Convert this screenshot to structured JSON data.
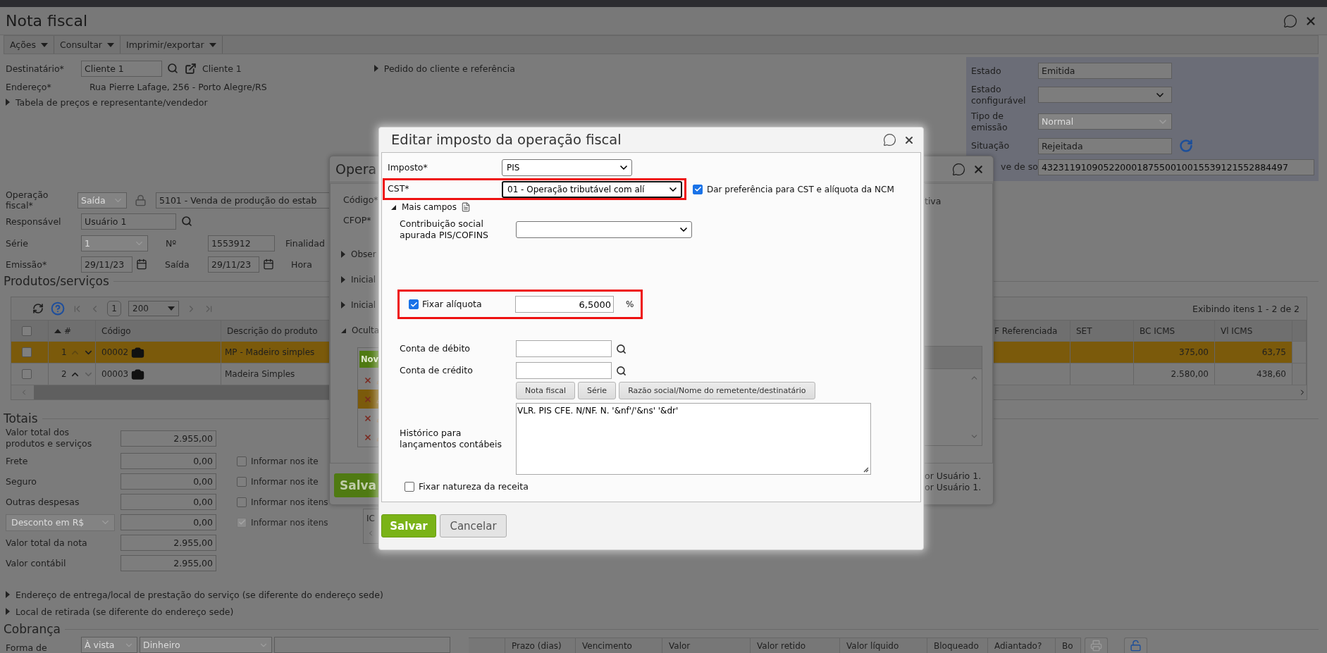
{
  "window": {
    "title": "Nota fiscal"
  },
  "menu": [
    {
      "label": "Ações"
    },
    {
      "label": "Consultar"
    },
    {
      "label": "Imprimir/exportar"
    }
  ],
  "header": {
    "recipient": {
      "label": "Destinatário*",
      "value": "Cliente 1",
      "link": "Cliente 1"
    },
    "address": {
      "label": "Endereço*",
      "value": "Rua Pierre Lafage, 256 - Porto Alegre/RS"
    },
    "price_section": {
      "label": "Tabela de preços e representante/vendedor",
      "expanded": false
    },
    "order_section": {
      "label": "Pedido do cliente e referência",
      "expanded": false
    }
  },
  "status_panel": [
    {
      "kind": "text",
      "label": "Estado",
      "value": "Emitida",
      "disabled": true,
      "refresh": false
    },
    {
      "kind": "select",
      "label": "Estado configurável",
      "disabled": false,
      "refresh": false
    },
    {
      "kind": "select",
      "label": "Tipo de emissão",
      "value": "Normal",
      "disabled": true,
      "refresh": false
    },
    {
      "kind": "text",
      "label": "Situação",
      "value": "Rejeitada",
      "disabled": true,
      "refresh": true
    },
    {
      "kind": "text",
      "label": "ve de so",
      "value": "43231191090522000187550010015539121552884497",
      "disabled": false,
      "refresh": false
    }
  ],
  "operation": {
    "label": "Operação fiscal*",
    "direction": "Saída",
    "cfop": "5101 - Venda de produção do estab"
  },
  "responsible": {
    "label": "Responsável",
    "value": "Usuário 1"
  },
  "series": {
    "label": "Série",
    "value": "1",
    "number_label": "Nº",
    "number": "1553912",
    "purpose_label": "Finalidad"
  },
  "dates": {
    "issue_label": "Emissão*",
    "issue": "29/11/23",
    "exit_label": "Saída",
    "exit": "29/11/23",
    "time_label": "Hora"
  },
  "products": {
    "title": "Produtos/serviços",
    "page": "1",
    "page_size": "200",
    "summary": "Exibindo itens 1 - 2 de 2",
    "header_checked": false,
    "columns": [
      {
        "label": "#",
        "sorted": true
      },
      {
        "label": "Código",
        "sorted": false
      },
      {
        "label": "Descrição do produto",
        "sorted": false
      },
      {
        "label": "F Referenciada",
        "sorted": false
      },
      {
        "label": "SET",
        "sorted": false
      },
      {
        "label": "BC ICMS",
        "sorted": false
      },
      {
        "label": "Vl ICMS",
        "sorted": false
      }
    ],
    "rows": [
      {
        "number": "1",
        "code": "00002",
        "description": "MP - Madeiro simples",
        "bc_icms": "375,00",
        "vl_icms": "63,75",
        "selected": true,
        "checked": false,
        "can_move_up": false,
        "can_move_down": true
      },
      {
        "number": "2",
        "code": "00003",
        "description": "Madeira Simples",
        "bc_icms": "2.580,00",
        "vl_icms": "438,60",
        "selected": false,
        "checked": false,
        "can_move_up": true,
        "can_move_down": false
      }
    ]
  },
  "totals": {
    "title": "Totais",
    "rows": [
      {
        "kind": "input",
        "label": "Valor total dos produtos e serviços",
        "value": "2.955,00"
      },
      {
        "kind": "input",
        "label": "Frete",
        "value": "0,00",
        "inform": {
          "label": "Informar nos ite",
          "checked": false,
          "disabled": false
        }
      },
      {
        "kind": "input",
        "label": "Seguro",
        "value": "0,00",
        "inform": {
          "label": "Informar nos ite",
          "checked": false,
          "disabled": false
        }
      },
      {
        "kind": "input",
        "label": "Outras despesas",
        "value": "0,00",
        "inform": {
          "label": "Informar nos itens",
          "checked": false,
          "disabled": false
        }
      },
      {
        "kind": "select",
        "label": "Desconto em R$",
        "value": "0,00",
        "inform": {
          "label": "Informar nos itens",
          "checked": true,
          "disabled": true
        }
      },
      {
        "kind": "input",
        "label": "Valor total da nota",
        "value": "2.955,00"
      },
      {
        "kind": "input",
        "label": "Valor contábil",
        "value": "2.955,00"
      }
    ]
  },
  "sections": [
    {
      "label": "Endereço de entrega/local de prestação do serviço (se diferente do endereço sede)",
      "expanded": false
    },
    {
      "label": "Local de retirada (se diferente do endereço sede)",
      "expanded": false
    }
  ],
  "billing": {
    "title": "Cobrança",
    "form_label": "Forma de",
    "term": "À vista",
    "method": "Dinheiro",
    "columns": [
      {
        "label": "Prazo (dias)"
      },
      {
        "label": "Vencimento"
      },
      {
        "label": "Valor"
      },
      {
        "label": "Valor retido"
      },
      {
        "label": "Valor líquido"
      },
      {
        "label": "Bloqueado"
      },
      {
        "label": "Adiantado?"
      },
      {
        "label": "Bo"
      }
    ]
  },
  "fragment": {
    "label": "IC"
  },
  "operation_dialog": {
    "title": "Opera",
    "labels": [
      "Código*",
      "CFOP*"
    ],
    "sections": [
      {
        "label": "Obser",
        "expanded": false
      },
      {
        "label": "Inicial",
        "expanded": false
      },
      {
        "label": "Inicial",
        "expanded": false
      },
      {
        "label": "Oculta",
        "expanded": true
      }
    ],
    "new_button": "Nov",
    "rows": [
      {
        "selected": false
      },
      {
        "selected": true
      },
      {
        "selected": false
      },
      {
        "selected": false
      }
    ],
    "save_button": "Salva",
    "right_label": "tiva",
    "log": [
      "or Usuário 1.",
      "or Usuário 1."
    ]
  },
  "tax_dialog": {
    "title": "Editar imposto da operação fiscal",
    "tax": {
      "label": "Imposto*",
      "value": "PIS"
    },
    "cst": {
      "label": "CST*",
      "value": "01 - Operação tributável com alí",
      "highlighted": true
    },
    "prefer_ncm": {
      "label": "Dar preferência para CST e alíquota da NCM",
      "checked": true
    },
    "more_fields": {
      "label": "Mais campos",
      "expanded": true
    },
    "contribution": {
      "label": "Contribuição social apurada PIS/COFINS"
    },
    "fixed_rate": {
      "label": "Fixar alíquota",
      "checked": true,
      "value": "6,5000",
      "unit": "%",
      "highlighted": true
    },
    "debit_account": {
      "label": "Conta de débito"
    },
    "credit_account": {
      "label": "Conta de crédito"
    },
    "insert_buttons": [
      "Nota fiscal",
      "Série",
      "Razão social/Nome do remetente/destinatário"
    ],
    "history": {
      "label": "Histórico para lançamentos contábeis",
      "value": "VLR. PIS CFE. N/NF. N. '&nf'/'&ns' '&dr'"
    },
    "fix_nature": {
      "label": "Fixar natureza da receita",
      "checked": false
    },
    "buttons": [
      {
        "kind": "primary",
        "label": "Salvar"
      },
      {
        "kind": "secondary",
        "label": "Cancelar"
      }
    ]
  }
}
